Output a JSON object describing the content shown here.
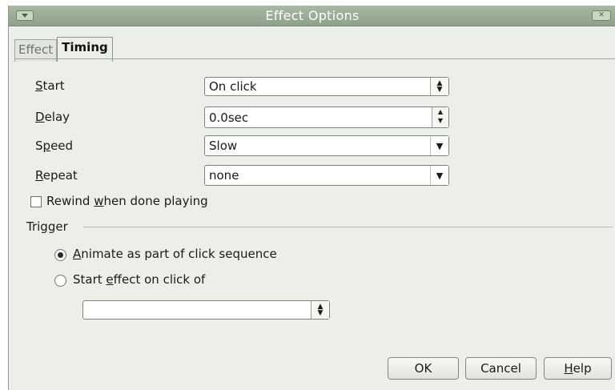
{
  "window": {
    "title": "Effect Options"
  },
  "tabs": [
    {
      "label": "Effect",
      "active": false
    },
    {
      "label": "Timing",
      "active": true
    }
  ],
  "fields": {
    "start": {
      "label_mnemonic": "S",
      "label_rest": "tart",
      "value": "On click"
    },
    "delay": {
      "label_mnemonic": "D",
      "label_rest": "elay",
      "value": "0.0sec"
    },
    "speed": {
      "label_pre": "S",
      "label_mnemonic": "p",
      "label_rest": "eed",
      "value": "Slow"
    },
    "repeat": {
      "label_mnemonic": "R",
      "label_rest": "epeat",
      "value": "none"
    }
  },
  "rewind": {
    "label_pre": "Rewind ",
    "label_mnemonic": "w",
    "label_rest": "hen done playing",
    "checked": false
  },
  "trigger": {
    "label": "Trigger",
    "options": [
      {
        "label_mnemonic": "A",
        "label_rest": "nimate as part of click sequence",
        "selected": true
      },
      {
        "label_pre": "Start ",
        "label_mnemonic": "e",
        "label_rest": "ffect on click of",
        "selected": false
      }
    ],
    "target_value": ""
  },
  "buttons": {
    "ok": "OK",
    "cancel": "Cancel",
    "help_mnemonic": "H",
    "help_rest": "elp"
  },
  "colors": {
    "titlebar": "#9aab95",
    "dialog_bg": "#ecefe9"
  }
}
